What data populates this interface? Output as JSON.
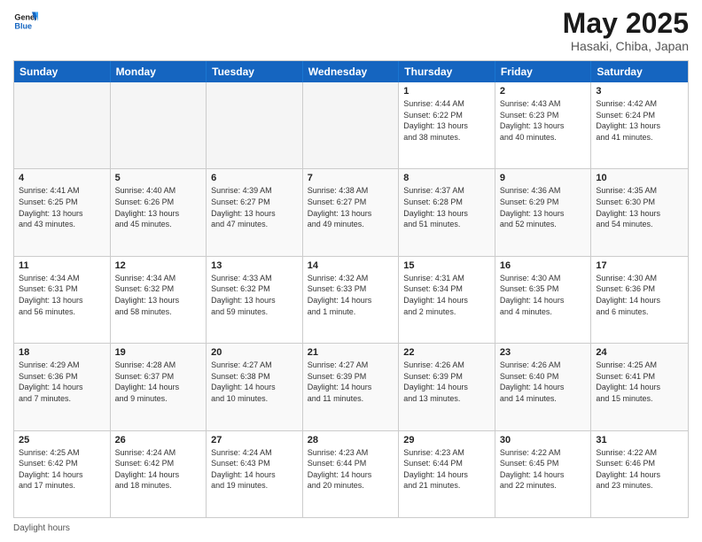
{
  "logo": {
    "line1": "General",
    "line2": "Blue"
  },
  "title": "May 2025",
  "subtitle": "Hasaki, Chiba, Japan",
  "headers": [
    "Sunday",
    "Monday",
    "Tuesday",
    "Wednesday",
    "Thursday",
    "Friday",
    "Saturday"
  ],
  "rows": [
    [
      {
        "day": "",
        "text": "",
        "empty": true
      },
      {
        "day": "",
        "text": "",
        "empty": true
      },
      {
        "day": "",
        "text": "",
        "empty": true
      },
      {
        "day": "",
        "text": "",
        "empty": true
      },
      {
        "day": "1",
        "text": "Sunrise: 4:44 AM\nSunset: 6:22 PM\nDaylight: 13 hours\nand 38 minutes."
      },
      {
        "day": "2",
        "text": "Sunrise: 4:43 AM\nSunset: 6:23 PM\nDaylight: 13 hours\nand 40 minutes."
      },
      {
        "day": "3",
        "text": "Sunrise: 4:42 AM\nSunset: 6:24 PM\nDaylight: 13 hours\nand 41 minutes."
      }
    ],
    [
      {
        "day": "4",
        "text": "Sunrise: 4:41 AM\nSunset: 6:25 PM\nDaylight: 13 hours\nand 43 minutes."
      },
      {
        "day": "5",
        "text": "Sunrise: 4:40 AM\nSunset: 6:26 PM\nDaylight: 13 hours\nand 45 minutes."
      },
      {
        "day": "6",
        "text": "Sunrise: 4:39 AM\nSunset: 6:27 PM\nDaylight: 13 hours\nand 47 minutes."
      },
      {
        "day": "7",
        "text": "Sunrise: 4:38 AM\nSunset: 6:27 PM\nDaylight: 13 hours\nand 49 minutes."
      },
      {
        "day": "8",
        "text": "Sunrise: 4:37 AM\nSunset: 6:28 PM\nDaylight: 13 hours\nand 51 minutes."
      },
      {
        "day": "9",
        "text": "Sunrise: 4:36 AM\nSunset: 6:29 PM\nDaylight: 13 hours\nand 52 minutes."
      },
      {
        "day": "10",
        "text": "Sunrise: 4:35 AM\nSunset: 6:30 PM\nDaylight: 13 hours\nand 54 minutes."
      }
    ],
    [
      {
        "day": "11",
        "text": "Sunrise: 4:34 AM\nSunset: 6:31 PM\nDaylight: 13 hours\nand 56 minutes."
      },
      {
        "day": "12",
        "text": "Sunrise: 4:34 AM\nSunset: 6:32 PM\nDaylight: 13 hours\nand 58 minutes."
      },
      {
        "day": "13",
        "text": "Sunrise: 4:33 AM\nSunset: 6:32 PM\nDaylight: 13 hours\nand 59 minutes."
      },
      {
        "day": "14",
        "text": "Sunrise: 4:32 AM\nSunset: 6:33 PM\nDaylight: 14 hours\nand 1 minute."
      },
      {
        "day": "15",
        "text": "Sunrise: 4:31 AM\nSunset: 6:34 PM\nDaylight: 14 hours\nand 2 minutes."
      },
      {
        "day": "16",
        "text": "Sunrise: 4:30 AM\nSunset: 6:35 PM\nDaylight: 14 hours\nand 4 minutes."
      },
      {
        "day": "17",
        "text": "Sunrise: 4:30 AM\nSunset: 6:36 PM\nDaylight: 14 hours\nand 6 minutes."
      }
    ],
    [
      {
        "day": "18",
        "text": "Sunrise: 4:29 AM\nSunset: 6:36 PM\nDaylight: 14 hours\nand 7 minutes."
      },
      {
        "day": "19",
        "text": "Sunrise: 4:28 AM\nSunset: 6:37 PM\nDaylight: 14 hours\nand 9 minutes."
      },
      {
        "day": "20",
        "text": "Sunrise: 4:27 AM\nSunset: 6:38 PM\nDaylight: 14 hours\nand 10 minutes."
      },
      {
        "day": "21",
        "text": "Sunrise: 4:27 AM\nSunset: 6:39 PM\nDaylight: 14 hours\nand 11 minutes."
      },
      {
        "day": "22",
        "text": "Sunrise: 4:26 AM\nSunset: 6:39 PM\nDaylight: 14 hours\nand 13 minutes."
      },
      {
        "day": "23",
        "text": "Sunrise: 4:26 AM\nSunset: 6:40 PM\nDaylight: 14 hours\nand 14 minutes."
      },
      {
        "day": "24",
        "text": "Sunrise: 4:25 AM\nSunset: 6:41 PM\nDaylight: 14 hours\nand 15 minutes."
      }
    ],
    [
      {
        "day": "25",
        "text": "Sunrise: 4:25 AM\nSunset: 6:42 PM\nDaylight: 14 hours\nand 17 minutes."
      },
      {
        "day": "26",
        "text": "Sunrise: 4:24 AM\nSunset: 6:42 PM\nDaylight: 14 hours\nand 18 minutes."
      },
      {
        "day": "27",
        "text": "Sunrise: 4:24 AM\nSunset: 6:43 PM\nDaylight: 14 hours\nand 19 minutes."
      },
      {
        "day": "28",
        "text": "Sunrise: 4:23 AM\nSunset: 6:44 PM\nDaylight: 14 hours\nand 20 minutes."
      },
      {
        "day": "29",
        "text": "Sunrise: 4:23 AM\nSunset: 6:44 PM\nDaylight: 14 hours\nand 21 minutes."
      },
      {
        "day": "30",
        "text": "Sunrise: 4:22 AM\nSunset: 6:45 PM\nDaylight: 14 hours\nand 22 minutes."
      },
      {
        "day": "31",
        "text": "Sunrise: 4:22 AM\nSunset: 6:46 PM\nDaylight: 14 hours\nand 23 minutes."
      }
    ]
  ],
  "footer": "Daylight hours"
}
